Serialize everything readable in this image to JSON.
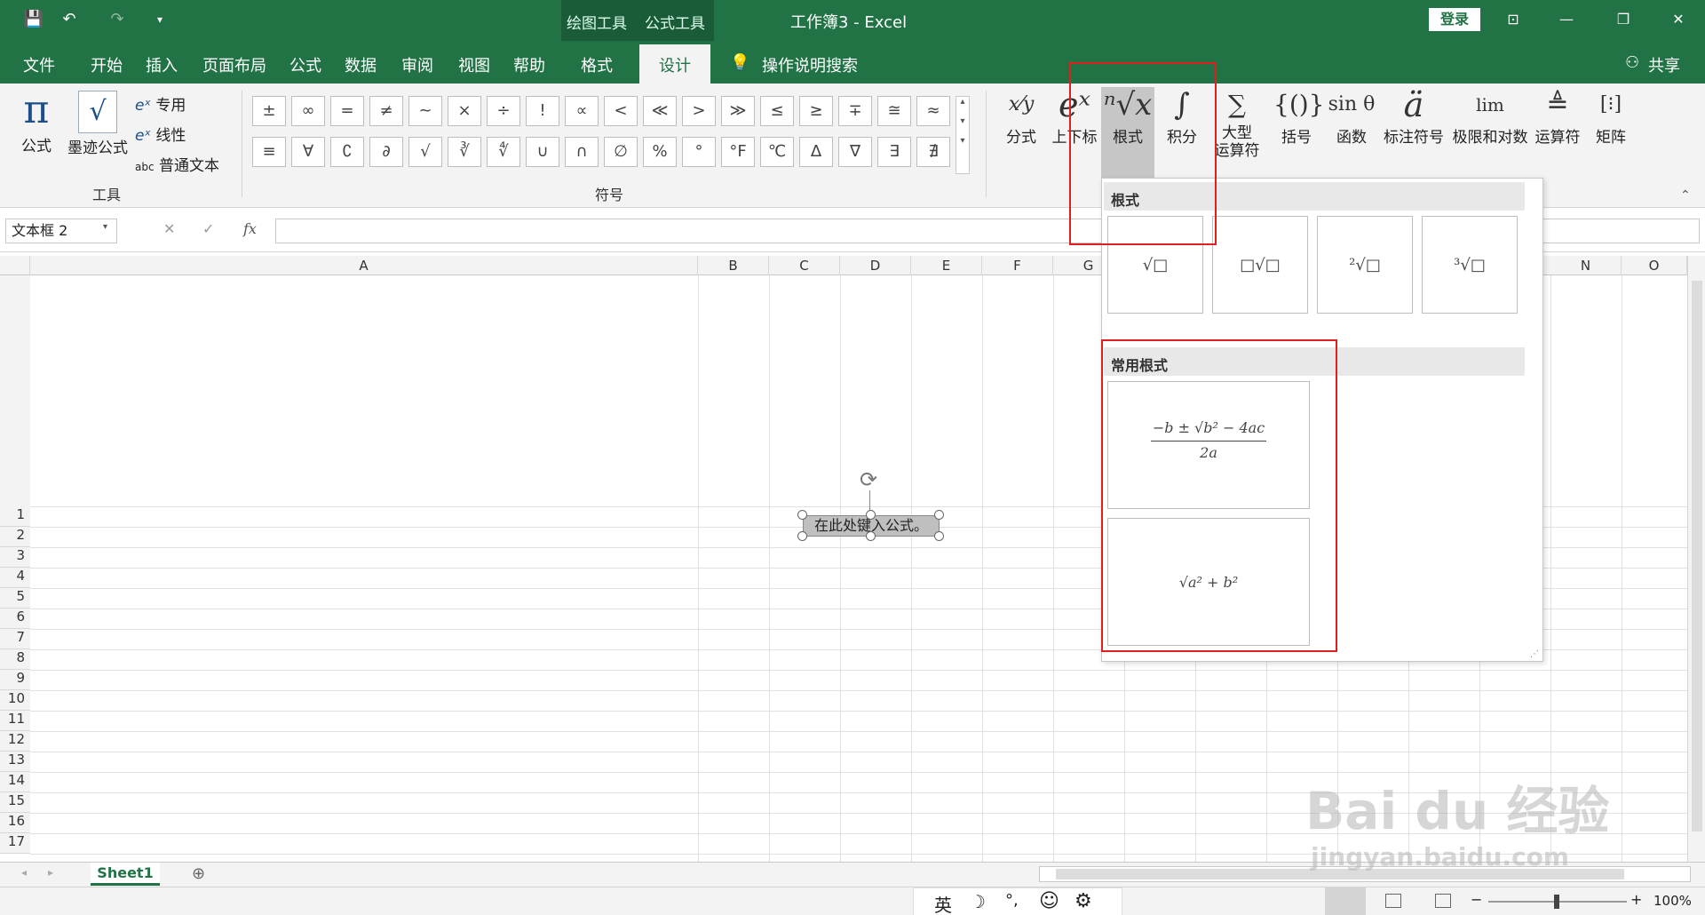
{
  "title_bar": {
    "qat_save": "💾",
    "qat_undo": "↶",
    "qat_redo": "↷",
    "qat_more": "▾",
    "ctx_drawing": "绘图工具",
    "ctx_formula": "公式工具",
    "doc_title": "工作簿3 - Excel",
    "login": "登录",
    "ribbon_display": "⊡",
    "minimize": "—",
    "restore": "❐",
    "close": "✕"
  },
  "tabs": {
    "file": "文件",
    "home": "开始",
    "insert": "插入",
    "page_layout": "页面布局",
    "formulas": "公式",
    "data": "数据",
    "review": "审阅",
    "view": "视图",
    "help": "帮助",
    "format": "格式",
    "design": "设计",
    "search": "操作说明搜索",
    "share": "共享"
  },
  "ribbon": {
    "tools": {
      "equation": "公式",
      "ink_equation": "墨迹公式",
      "professional": "专用",
      "linear": "线性",
      "normal_text": "普通文本",
      "abc": "abc",
      "group_label": "工具"
    },
    "symbols": {
      "group_label": "符号",
      "row1": [
        "±",
        "∞",
        "=",
        "≠",
        "~",
        "×",
        "÷",
        "!",
        "∝",
        "<",
        "≪",
        ">",
        "≫",
        "≤",
        "≥",
        "∓",
        "≅",
        "≈"
      ],
      "row2": [
        "≡",
        "∀",
        "∁",
        "∂",
        "√",
        "∛",
        "∜",
        "∪",
        "∩",
        "∅",
        "%",
        "°",
        "°F",
        "℃",
        "∆",
        "∇",
        "∃",
        "∄"
      ]
    },
    "structures": {
      "fraction": "分式",
      "script": "上下标",
      "radical": "根式",
      "integral": "积分",
      "large_operator_1": "大型",
      "large_operator_2": "运算符",
      "bracket": "括号",
      "function": "函数",
      "accent": "标注符号",
      "limit_log": "极限和对数",
      "operator": "运算符",
      "matrix": "矩阵"
    }
  },
  "formula_bar": {
    "name_box": "文本框 2",
    "cancel": "✕",
    "enter": "✓",
    "fx": "fx"
  },
  "columns": [
    "A",
    "B",
    "C",
    "D",
    "E",
    "F",
    "G",
    "N",
    "O"
  ],
  "rows": [
    "1",
    "2",
    "3",
    "4",
    "5",
    "6",
    "7",
    "8",
    "9",
    "10",
    "11",
    "12",
    "13",
    "14",
    "15",
    "16",
    "17"
  ],
  "equation_placeholder": "在此处键入公式。",
  "dropdown": {
    "section_radical": "根式",
    "section_common": "常用根式",
    "item_sqrt": "√□",
    "item_nroot": "□√□",
    "item_sqrt2": "²√□",
    "item_sqrt3": "³√□",
    "common_quadratic_num": "−b ± √b² − 4ac",
    "common_quadratic_den": "2a",
    "common_pythag": "√a² + b²"
  },
  "sheet": {
    "tab": "Sheet1",
    "add": "⊕"
  },
  "status": {
    "ime_lang": "英",
    "ime_moon": "☽",
    "ime_punct": "°,",
    "ime_emoji": "☺",
    "ime_settings": "⚙",
    "zoom_minus": "−",
    "zoom_plus": "+",
    "zoom": "100%"
  },
  "watermark": {
    "logo": "Bai du 经验",
    "url": "jingyan.baidu.com"
  }
}
